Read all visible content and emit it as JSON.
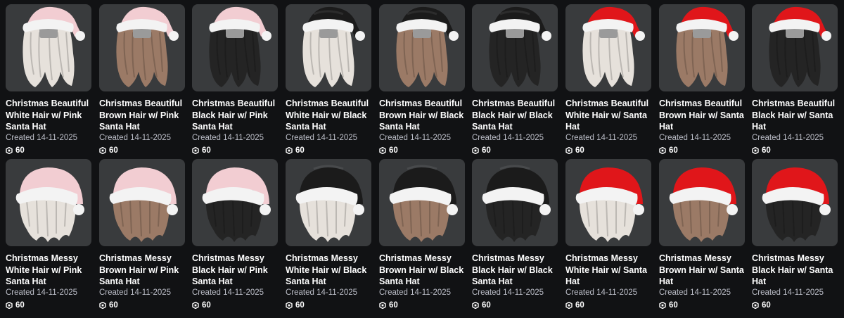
{
  "items": [
    {
      "title": "Christmas Beautiful White Hair w/ Pink Santa Hat",
      "created": "Created 14-11-2025",
      "price": "60",
      "style": "long",
      "hair_color": "#e6e1db",
      "hat_color": "#f2cdd2"
    },
    {
      "title": "Christmas Beautiful Brown Hair w/ Pink Santa Hat",
      "created": "Created 14-11-2025",
      "price": "60",
      "style": "long",
      "hair_color": "#9b7a66",
      "hat_color": "#f2cdd2"
    },
    {
      "title": "Christmas Beautiful Black Hair w/ Pink Santa Hat",
      "created": "Created 14-11-2025",
      "price": "60",
      "style": "long",
      "hair_color": "#242424",
      "hat_color": "#f2cdd2"
    },
    {
      "title": "Christmas Beautiful White Hair w/ Black Santa Hat",
      "created": "Created 14-11-2025",
      "price": "60",
      "style": "long",
      "hair_color": "#e6e1db",
      "hat_color": "#1b1b1b"
    },
    {
      "title": "Christmas Beautiful Brown Hair w/ Black Santa Hat",
      "created": "Created 14-11-2025",
      "price": "60",
      "style": "long",
      "hair_color": "#9b7a66",
      "hat_color": "#1b1b1b"
    },
    {
      "title": "Christmas Beautiful Black Hair w/ Black Santa Hat",
      "created": "Created 14-11-2025",
      "price": "60",
      "style": "long",
      "hair_color": "#242424",
      "hat_color": "#1b1b1b"
    },
    {
      "title": "Christmas Beautiful White Hair w/ Santa Hat",
      "created": "Created 14-11-2025",
      "price": "60",
      "style": "long",
      "hair_color": "#e6e1db",
      "hat_color": "#e0161a"
    },
    {
      "title": "Christmas Beautiful Brown Hair w/ Santa Hat",
      "created": "Created 14-11-2025",
      "price": "60",
      "style": "long",
      "hair_color": "#9b7a66",
      "hat_color": "#e0161a"
    },
    {
      "title": "Christmas Beautiful Black Hair w/ Santa Hat",
      "created": "Created 14-11-2025",
      "price": "60",
      "style": "long",
      "hair_color": "#242424",
      "hat_color": "#e0161a"
    },
    {
      "title": "Christmas Messy White Hair w/ Pink Santa Hat",
      "created": "Created 14-11-2025",
      "price": "60",
      "style": "messy",
      "hair_color": "#e6e1db",
      "hat_color": "#f2cdd2"
    },
    {
      "title": "Christmas Messy Brown Hair w/ Pink Santa Hat",
      "created": "Created 14-11-2025",
      "price": "60",
      "style": "messy",
      "hair_color": "#9b7a66",
      "hat_color": "#f2cdd2"
    },
    {
      "title": "Christmas Messy Black Hair w/ Pink Santa Hat",
      "created": "Created 14-11-2025",
      "price": "60",
      "style": "messy",
      "hair_color": "#242424",
      "hat_color": "#f2cdd2"
    },
    {
      "title": "Christmas Messy White Hair w/ Black Santa Hat",
      "created": "Created 14-11-2025",
      "price": "60",
      "style": "messy",
      "hair_color": "#e6e1db",
      "hat_color": "#1b1b1b"
    },
    {
      "title": "Christmas Messy Brown Hair w/ Black Santa Hat",
      "created": "Created 14-11-2025",
      "price": "60",
      "style": "messy",
      "hair_color": "#9b7a66",
      "hat_color": "#1b1b1b"
    },
    {
      "title": "Christmas Messy Black Hair w/ Black Santa Hat",
      "created": "Created 14-11-2025",
      "price": "60",
      "style": "messy",
      "hair_color": "#242424",
      "hat_color": "#1b1b1b"
    },
    {
      "title": "Christmas Messy White Hair w/ Santa Hat",
      "created": "Created 14-11-2025",
      "price": "60",
      "style": "messy",
      "hair_color": "#e6e1db",
      "hat_color": "#e0161a"
    },
    {
      "title": "Christmas Messy Brown Hair w/ Santa Hat",
      "created": "Created 14-11-2025",
      "price": "60",
      "style": "messy",
      "hair_color": "#9b7a66",
      "hat_color": "#e0161a"
    },
    {
      "title": "Christmas Messy Black Hair w/ Santa Hat",
      "created": "Created 14-11-2025",
      "price": "60",
      "style": "messy",
      "hair_color": "#242424",
      "hat_color": "#e0161a"
    }
  ],
  "price_icon": "robux-icon",
  "colors": {
    "background": "#111214",
    "thumbnail_bg": "#393b3d",
    "title_text": "#ffffff",
    "meta_text": "#bcbec8",
    "fur": "#f3f3f3"
  }
}
